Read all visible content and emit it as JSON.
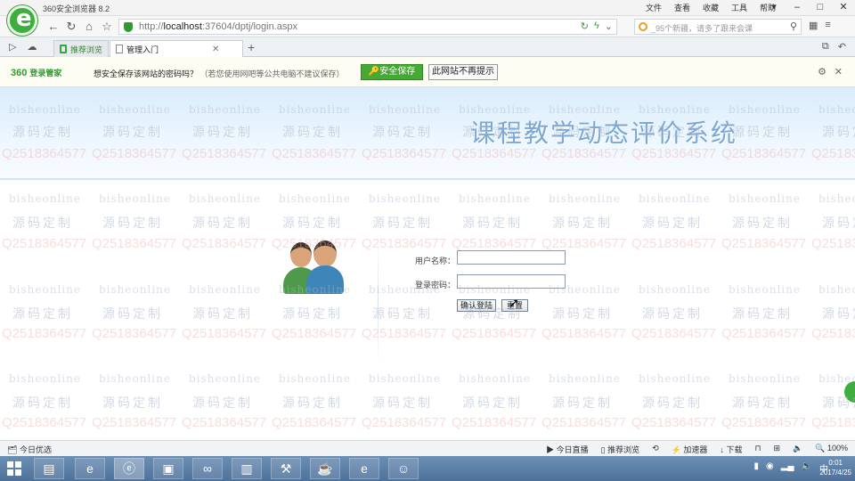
{
  "browser": {
    "title": "360安全浏览器 8.2",
    "menu": [
      "文件",
      "查看",
      "收藏",
      "工具",
      "帮助"
    ],
    "url_prefix": "http://",
    "url_host": "localhost",
    "url_rest": ":37604/dptj/login.aspx",
    "search_placeholder": "_95个新疆，请多了跟来会课",
    "tabs": [
      {
        "label": "推荐浏览"
      },
      {
        "label": "管理入门"
      }
    ]
  },
  "savebar": {
    "brand": "360",
    "brand_sub": "登录管家",
    "message": "想安全保存该网站的密码吗？",
    "hint": "（若您使用网吧等公共电脑不建议保存）",
    "save_button": "安全保存",
    "never_button": "此网站不再提示"
  },
  "page": {
    "system_title": "课程教学动态评价系统",
    "username_label": "用户名称：",
    "password_label": "登录密码：",
    "username_value": "",
    "password_value": "",
    "login_button": "确认登陆",
    "reset_button": "重置"
  },
  "watermarks": {
    "a": "bisheonline",
    "b": "源码定制",
    "c": "Q2518364577"
  },
  "statusbar": {
    "left": "今日优选",
    "items": [
      "今日直播",
      "推荐浏览",
      "加速器",
      "下载",
      "100%"
    ]
  },
  "taskbar": {
    "time": "0:01",
    "date": "2017/4/25"
  }
}
